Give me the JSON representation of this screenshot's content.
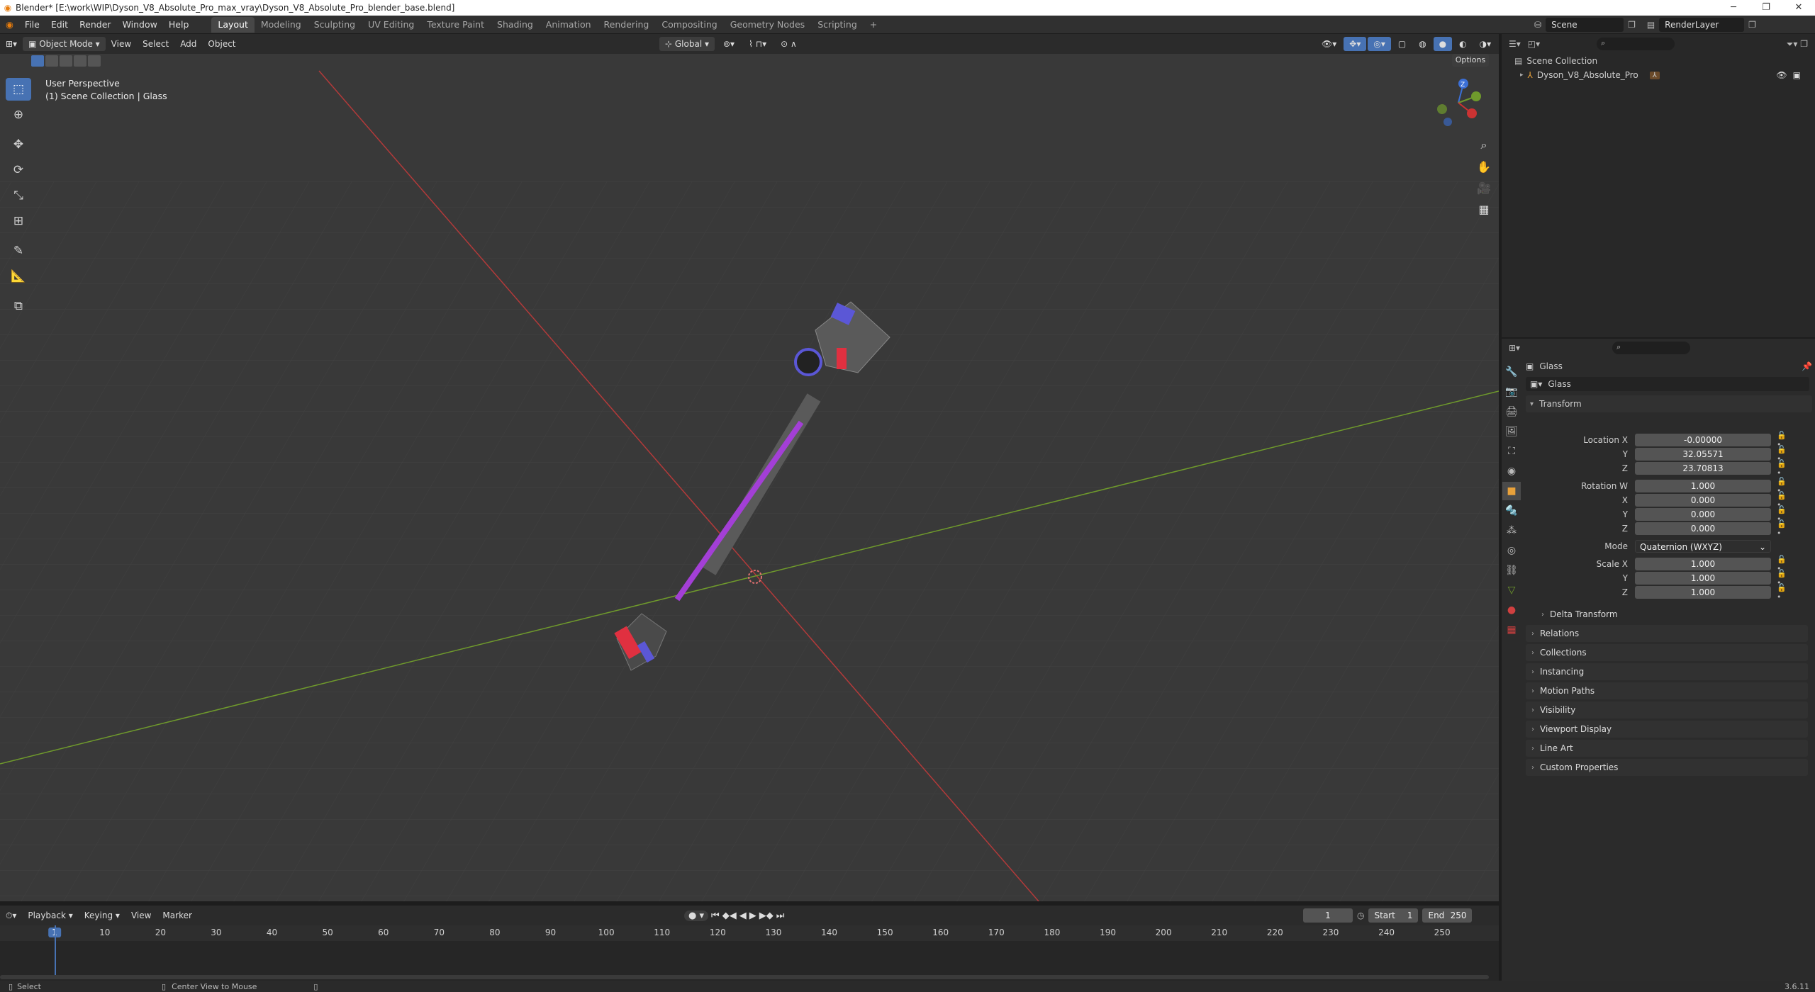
{
  "window": {
    "title": "Blender* [E:\\work\\WIP\\Dyson_V8_Absolute_Pro_max_vray\\Dyson_V8_Absolute_Pro_blender_base.blend]",
    "minimize": "─",
    "restore": "❐",
    "close": "✕"
  },
  "menu": [
    "File",
    "Edit",
    "Render",
    "Window",
    "Help"
  ],
  "workspaces": [
    "Layout",
    "Modeling",
    "Sculpting",
    "UV Editing",
    "Texture Paint",
    "Shading",
    "Animation",
    "Rendering",
    "Compositing",
    "Geometry Nodes",
    "Scripting"
  ],
  "workspace_add": "+",
  "scene": {
    "name": "Scene",
    "view_layer": "RenderLayer"
  },
  "viewport_header": {
    "mode": "Object Mode",
    "menus": [
      "View",
      "Select",
      "Add",
      "Object"
    ],
    "orientation": "Global",
    "options": "Options"
  },
  "viewport": {
    "perspective": "User Perspective",
    "collection_info": "(1) Scene Collection | Glass",
    "gizmo": {
      "x": "X",
      "y": "Y",
      "z": "Z"
    }
  },
  "outliner": {
    "root": "Scene Collection",
    "items": [
      {
        "name": "Dyson_V8_Absolute_Pro"
      }
    ]
  },
  "properties": {
    "object_name": "Glass",
    "datablock_name": "Glass",
    "transform_label": "Transform",
    "location": {
      "label": "Location X",
      "x": "-0.00000",
      "y": "32.05571",
      "z": "23.70813"
    },
    "rotation": {
      "label": "Rotation W",
      "w": "1.000",
      "x": "0.000",
      "y": "0.000",
      "z": "0.000"
    },
    "mode": {
      "label": "Mode",
      "value": "Quaternion (WXYZ)"
    },
    "scale": {
      "label": "Scale X",
      "x": "1.000",
      "y": "1.000",
      "z": "1.000"
    },
    "axis_labels": {
      "x": "X",
      "y": "Y",
      "z": "Z"
    },
    "subpanels": [
      "Delta Transform",
      "Relations",
      "Collections",
      "Instancing",
      "Motion Paths",
      "Visibility",
      "Viewport Display",
      "Line Art",
      "Custom Properties"
    ]
  },
  "timeline": {
    "menus": [
      "Playback",
      "Keying",
      "View",
      "Marker"
    ],
    "current_frame": "1",
    "start_label": "Start",
    "start": "1",
    "end_label": "End",
    "end": "250",
    "ticks": [
      "1",
      "10",
      "20",
      "30",
      "40",
      "50",
      "60",
      "70",
      "80",
      "90",
      "100",
      "110",
      "120",
      "130",
      "140",
      "150",
      "160",
      "170",
      "180",
      "190",
      "200",
      "210",
      "220",
      "230",
      "240",
      "250"
    ]
  },
  "status": {
    "left": "Select",
    "middle": "Center View to Mouse",
    "version": "3.6.11"
  },
  "colors": {
    "accent": "#4772b3",
    "x_axis": "#b33a3a",
    "y_axis": "#6f9a2c"
  }
}
